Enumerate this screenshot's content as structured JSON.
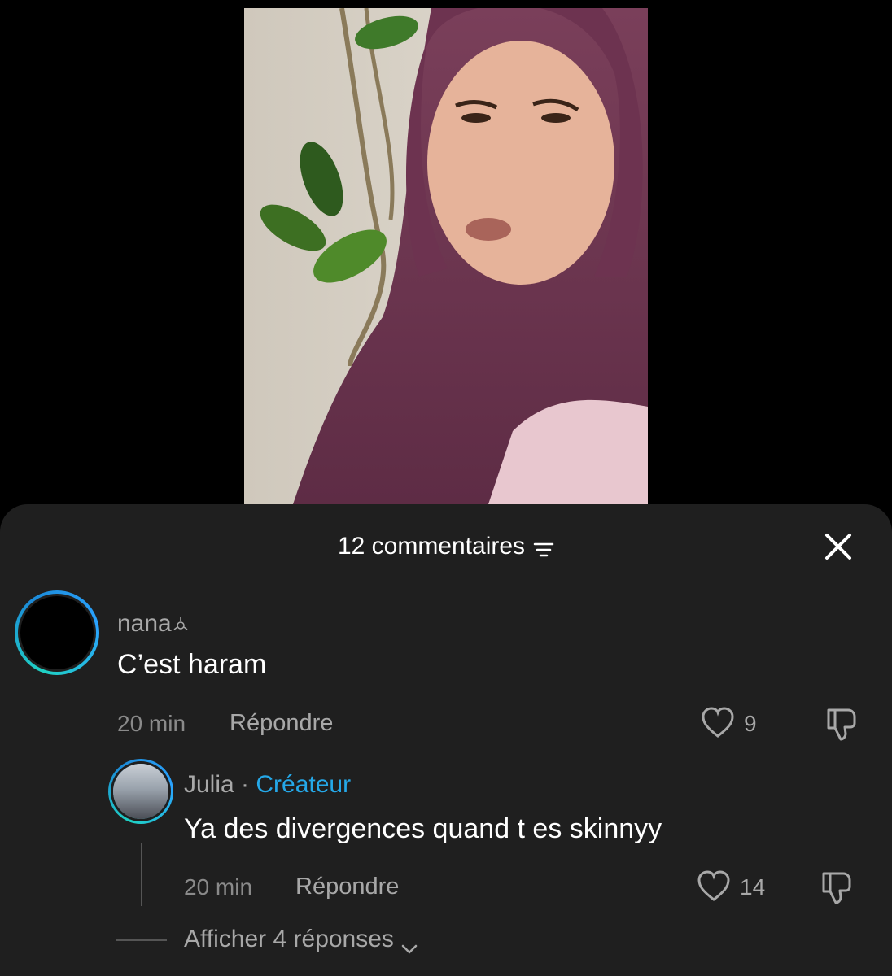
{
  "sheet": {
    "title": "12 commentaires",
    "icons": {
      "sort": "sort-lines-icon",
      "close": "close-icon"
    }
  },
  "comments": [
    {
      "username": "nana",
      "badge_icon": "sparkle-icon",
      "text": "C’est haram",
      "time": "20 min",
      "reply_label": "Répondre",
      "likes": "9"
    }
  ],
  "reply": {
    "username": "Julia",
    "separator": "·",
    "creator_label": "Créateur",
    "text": "Ya des divergences quand t es skinnyy",
    "time": "20 min",
    "reply_label": "Répondre",
    "likes": "14"
  },
  "more_replies_label": "Afficher 4 réponses",
  "colors": {
    "sheet_bg": "#1f1f1f",
    "accent": "#25a8e8",
    "ring": "#1fd1c3"
  }
}
